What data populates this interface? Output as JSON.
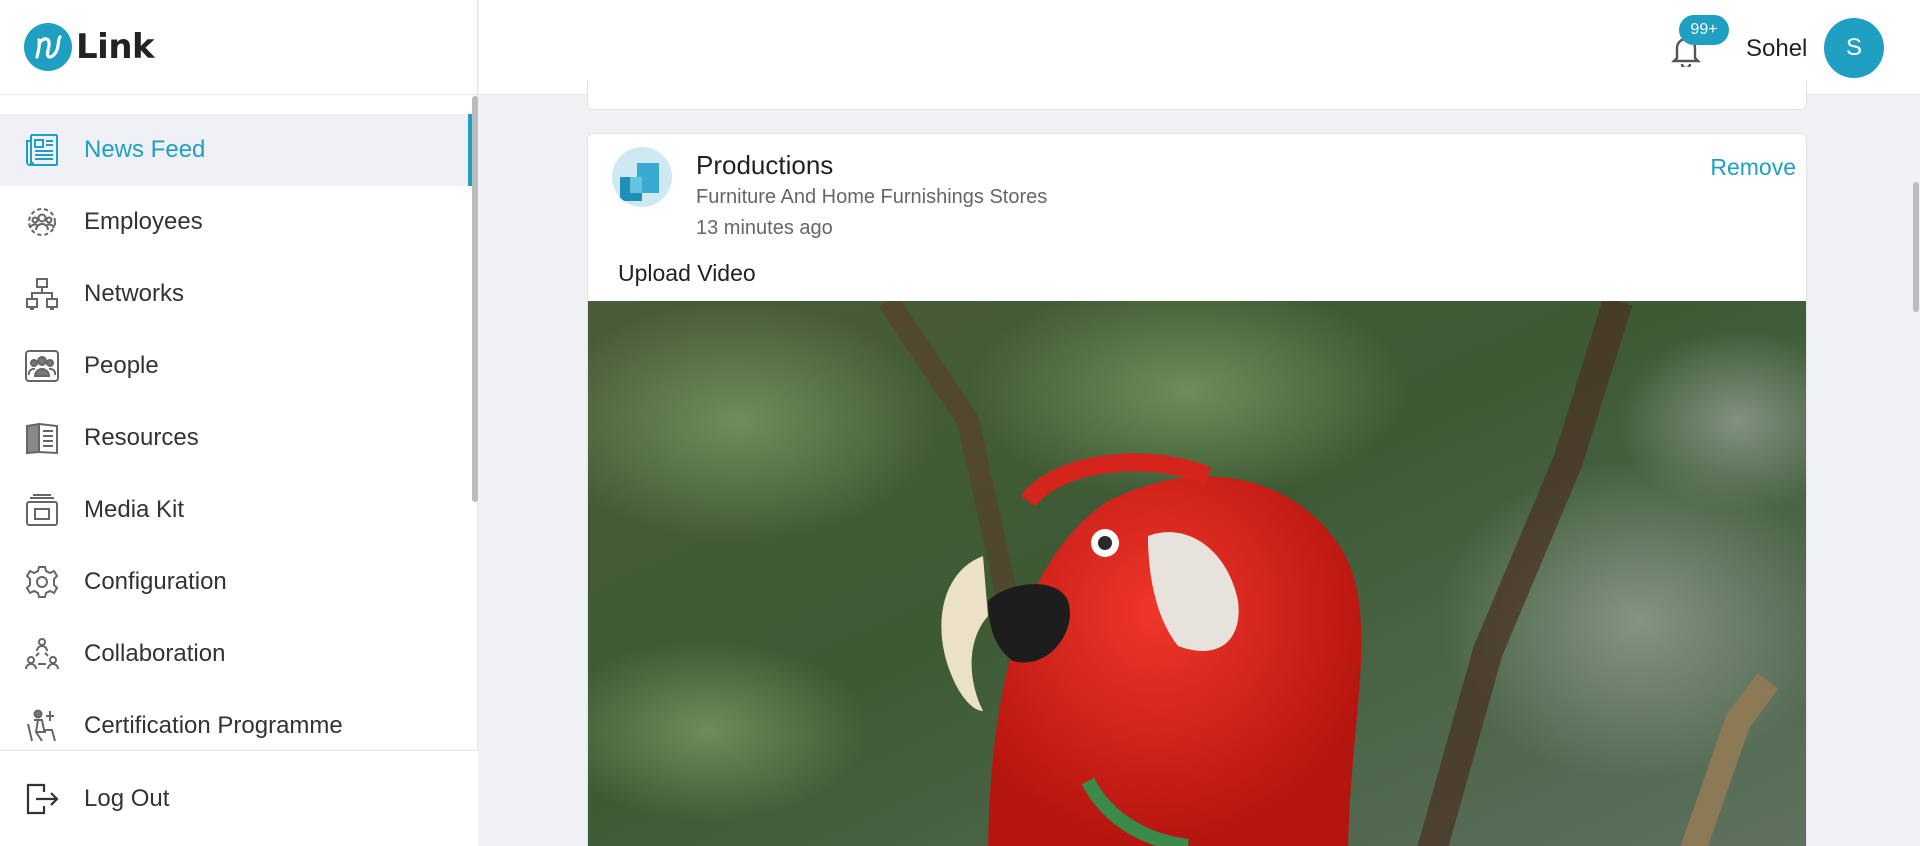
{
  "brand": {
    "logo_letter": "n",
    "name": "Link"
  },
  "sidebar": {
    "items": [
      {
        "label": "News Feed",
        "icon": "news-feed-icon",
        "active": true
      },
      {
        "label": "Employees",
        "icon": "employees-icon"
      },
      {
        "label": "Networks",
        "icon": "networks-icon"
      },
      {
        "label": "People",
        "icon": "people-icon"
      },
      {
        "label": "Resources",
        "icon": "resources-icon"
      },
      {
        "label": "Media Kit",
        "icon": "media-kit-icon"
      },
      {
        "label": "Configuration",
        "icon": "configuration-icon"
      },
      {
        "label": "Collaboration",
        "icon": "collaboration-icon"
      },
      {
        "label": "Certification Programme",
        "icon": "certification-icon"
      }
    ],
    "logout_label": "Log Out"
  },
  "header": {
    "notification_count": "99+",
    "user_name": "Sohel",
    "avatar_initial": "S"
  },
  "post": {
    "company": "Productions",
    "category": "Furniture And Home Furnishings Stores",
    "time": "13 minutes ago",
    "remove_label": "Remove",
    "text": "Upload Video",
    "media_icon": "parrot-video-thumbnail"
  },
  "colors": {
    "accent": "#1f9fc1",
    "sidebar_active_bg": "#eff1f7",
    "page_bg": "#f0f1f5"
  }
}
